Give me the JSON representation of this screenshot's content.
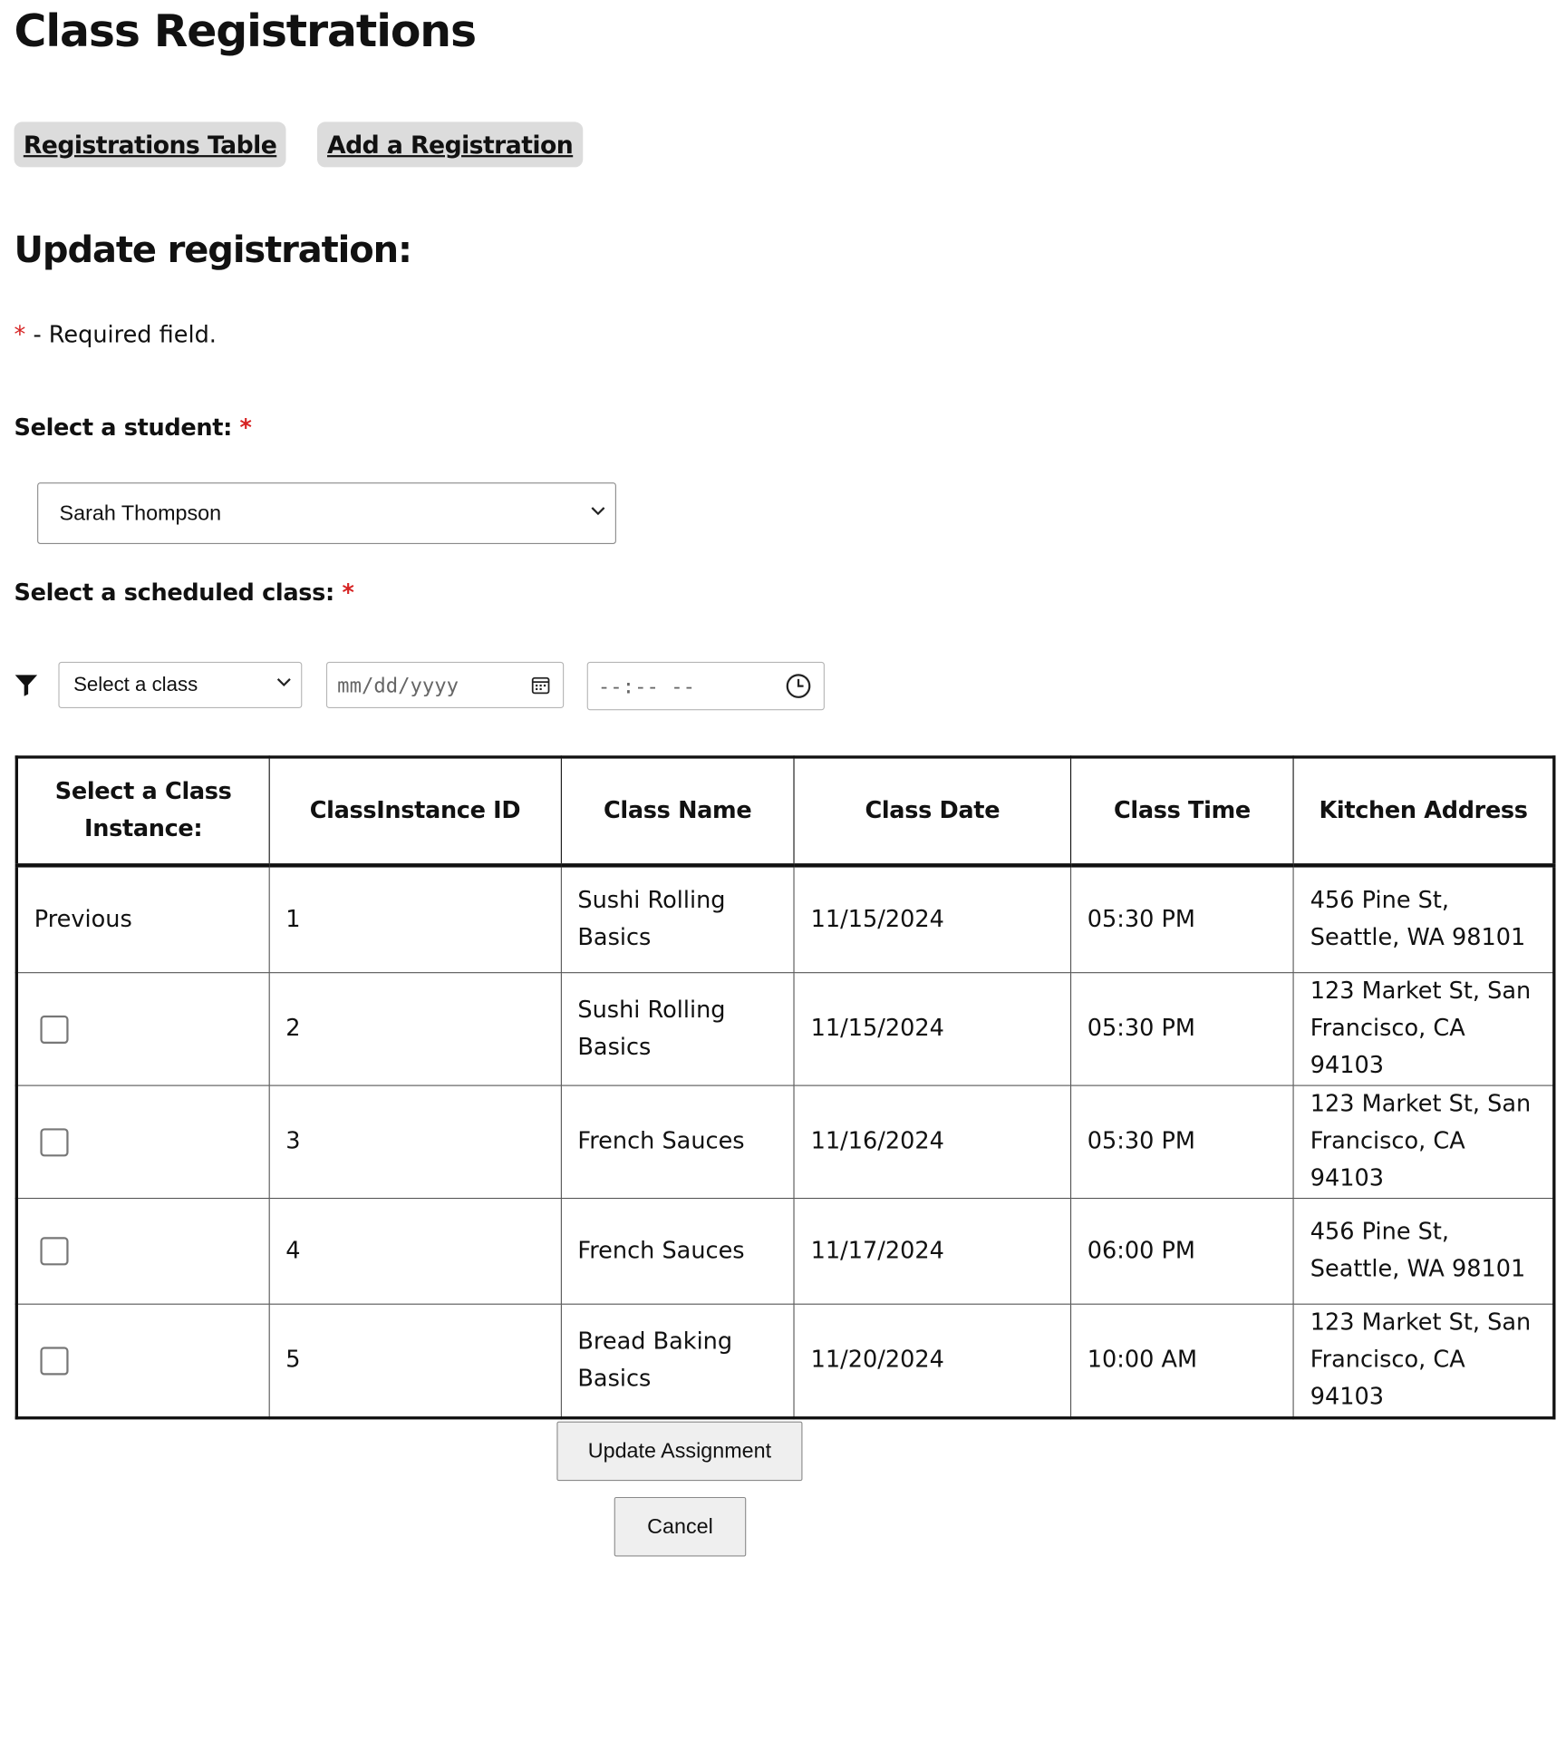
{
  "page_title": "Class Registrations",
  "nav": {
    "registrations_table": "Registrations Table",
    "add_registration": "Add a Registration"
  },
  "section_title": "Update registration:",
  "required_note": {
    "star": "*",
    "text": " - Required field."
  },
  "student_field": {
    "label": "Select a student:",
    "star": "*",
    "value": "Sarah Thompson"
  },
  "class_field": {
    "label": "Select a scheduled class:",
    "star": "*"
  },
  "filters": {
    "class_select": "Select a class",
    "date_placeholder": "mm/dd/yyyy",
    "time_placeholder": "--:-- --"
  },
  "table": {
    "headers": [
      "Select a Class Instance:",
      "ClassInstance ID",
      "Class Name",
      "Class Date",
      "Class Time",
      "Kitchen Address"
    ],
    "rows": [
      {
        "select": "Previous",
        "checkbox": false,
        "id": "1",
        "name": "Sushi Rolling Basics",
        "date": "11/15/2024",
        "time": "05:30 PM",
        "address": "456 Pine St, Seattle, WA 98101"
      },
      {
        "select": "",
        "checkbox": true,
        "checked": false,
        "id": "2",
        "name": "Sushi Rolling Basics",
        "date": "11/15/2024",
        "time": "05:30 PM",
        "address": "123 Market St, San Francisco, CA 94103"
      },
      {
        "select": "",
        "checkbox": true,
        "checked": false,
        "id": "3",
        "name": "French Sauces",
        "date": "11/16/2024",
        "time": "05:30 PM",
        "address": "123 Market St, San Francisco, CA 94103"
      },
      {
        "select": "",
        "checkbox": true,
        "checked": false,
        "id": "4",
        "name": "French Sauces",
        "date": "11/17/2024",
        "time": "06:00 PM",
        "address": "456 Pine St, Seattle, WA 98101"
      },
      {
        "select": "",
        "checkbox": true,
        "checked": false,
        "id": "5",
        "name": "Bread Baking Basics",
        "date": "11/20/2024",
        "time": "10:00 AM",
        "address": "123 Market St, San Francisco, CA 94103"
      }
    ]
  },
  "buttons": {
    "update": "Update Assignment",
    "cancel": "Cancel"
  },
  "icons": {
    "filter": "filter-icon",
    "calendar": "calendar-icon",
    "clock": "clock-icon",
    "chevron": "chevron-down-icon"
  },
  "colors": {
    "required_star": "#d62222",
    "nav_button_bg": "#dcdcdc"
  }
}
